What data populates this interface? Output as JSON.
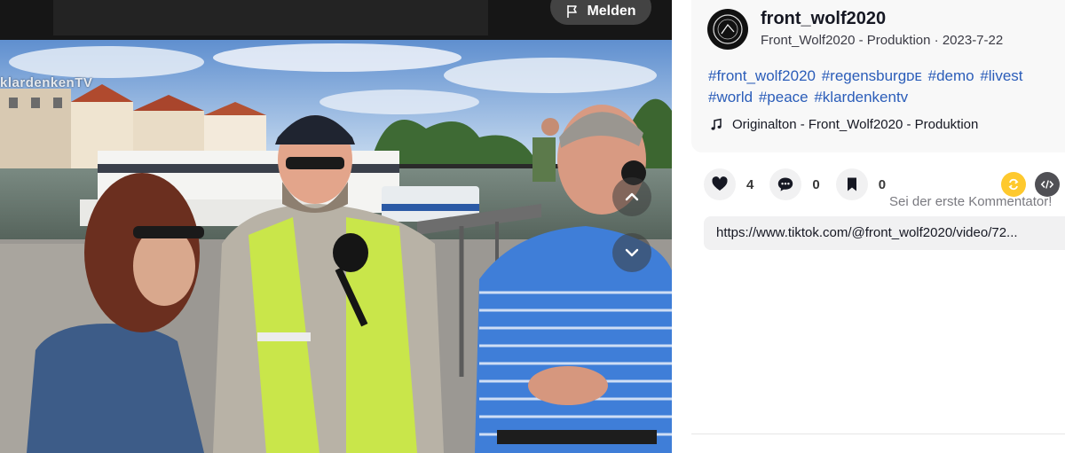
{
  "video": {
    "report_label": "Melden",
    "watermark": "klardenkenTV"
  },
  "post": {
    "username": "front_wolf2020",
    "subline": "Front_Wolf2020 - Produktion · 2023-7-22",
    "hashtags": [
      "#front_wolf2020",
      "#regensburgᴅᴇ",
      "#demo",
      "#livest",
      "#world",
      "#peace",
      "#klardenkentv"
    ],
    "music": "Originalton - Front_Wolf2020 - Produktion"
  },
  "actions": {
    "likes": "4",
    "comments": "0",
    "saves": "0"
  },
  "first_comment": "Sei der erste Kommentator!",
  "link": "https://www.tiktok.com/@front_wolf2020/video/72...",
  "colors": {
    "hashtag": "#2b5db9",
    "share_yellow": "#fec92e",
    "embed_dark": "#505055"
  }
}
